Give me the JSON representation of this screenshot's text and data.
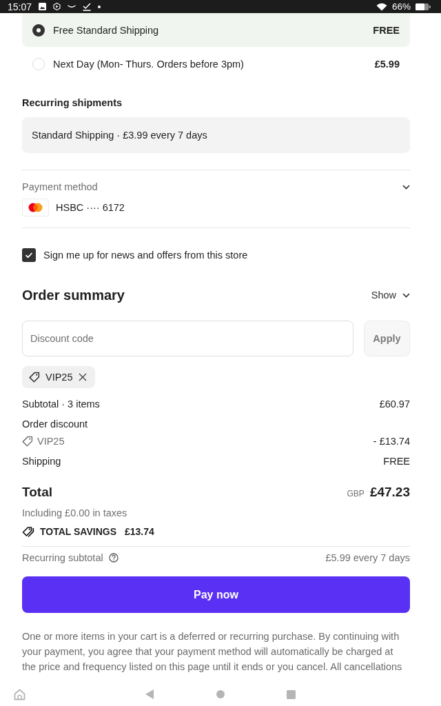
{
  "status_bar": {
    "time": "15:07",
    "battery": "66%"
  },
  "shipping_options": [
    {
      "label": "Free Standard Shipping",
      "price": "FREE",
      "selected": true
    },
    {
      "label": "Next Day (Mon- Thurs. Orders before 3pm)",
      "price": "£5.99",
      "selected": false
    }
  ],
  "recurring_shipments": {
    "title": "Recurring shipments",
    "summary": "Standard Shipping · £3.99 every 7 days"
  },
  "payment_method": {
    "label": "Payment method",
    "card": "HSBC ···· 6172"
  },
  "newsletter": {
    "label": "Sign me up for news and offers from this store",
    "checked": true
  },
  "order_summary": {
    "title": "Order summary",
    "toggle": "Show",
    "discount": {
      "placeholder": "Discount code",
      "apply_button": {
        "label": "Apply",
        "disabled": true
      }
    },
    "applied_codes": [
      {
        "code": "VIP25"
      }
    ],
    "lines": [
      {
        "kind": "plain",
        "label": "Subtotal · 3 items",
        "value": "£60.97"
      },
      {
        "kind": "heading",
        "label": "Order discount"
      },
      {
        "kind": "code",
        "label": "VIP25",
        "value": "- £13.74"
      },
      {
        "kind": "plain",
        "label": "Shipping",
        "value": "FREE"
      }
    ],
    "total": {
      "label": "Total",
      "currency": "GBP",
      "amount": "£47.23",
      "taxes": "Including £0.00 in taxes"
    },
    "savings": {
      "label": "TOTAL SAVINGS",
      "amount": "£13.74"
    },
    "recurring_subtotal": {
      "label": "Recurring subtotal",
      "value": "£5.99 every 7 days"
    }
  },
  "pay_button": {
    "label": "Pay now"
  },
  "disclaimer": "One or more items in your cart is a deferred or recurring purchase. By continuing with your payment, you agree that your payment method will automatically be charged at the price and frequency listed on this page until it ends or you cancel. All cancellations"
}
